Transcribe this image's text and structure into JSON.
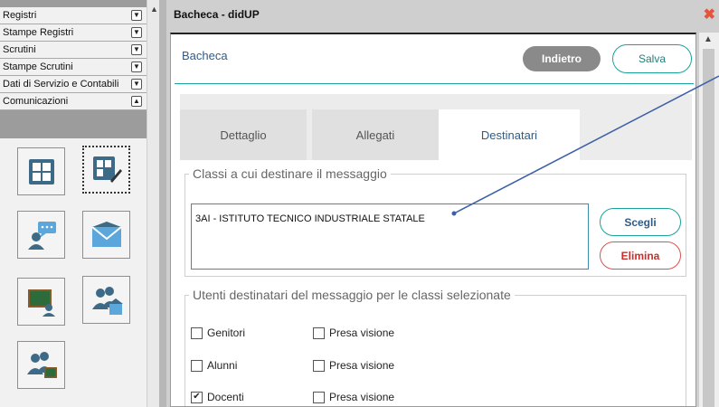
{
  "sidebar": {
    "menu": [
      {
        "label": "Registri",
        "toggle": "▼"
      },
      {
        "label": "Stampe Registri",
        "toggle": "▼"
      },
      {
        "label": "Scrutini",
        "toggle": "▼"
      },
      {
        "label": "Stampe Scrutini",
        "toggle": "▼"
      },
      {
        "label": "Dati di Servizio e Contabili",
        "toggle": "▼"
      },
      {
        "label": "Comunicazioni",
        "toggle": "▲"
      }
    ],
    "scroll_up": "▲",
    "tiles": [
      {
        "icon": "grid-board-icon"
      },
      {
        "icon": "grid-edit-icon"
      },
      {
        "icon": "person-chat-icon"
      },
      {
        "icon": "envelope-icon"
      },
      {
        "icon": "blackboard-teacher-icon"
      },
      {
        "icon": "people-building-icon"
      },
      {
        "icon": "people-board-icon"
      }
    ]
  },
  "dialog": {
    "title": "Bacheca - didUP",
    "close": "✖",
    "scroll_up": "▲"
  },
  "header": {
    "title": "Bacheca",
    "back_label": "Indietro",
    "save_label": "Salva"
  },
  "tabs": [
    {
      "label": "Dettaglio",
      "active": false
    },
    {
      "label": "Allegati",
      "active": false
    },
    {
      "label": "Destinatari",
      "active": true
    }
  ],
  "classes_section": {
    "legend": "Classi a cui destinare il messaggio",
    "value": "3AI - ISTITUTO TECNICO INDUSTRIALE STATALE",
    "choose_label": "Scegli",
    "remove_label": "Elimina"
  },
  "users_section": {
    "legend": "Utenti destinatari del messaggio per le classi selezionate",
    "rows": [
      {
        "label": "Genitori",
        "checked": false,
        "view_label": "Presa visione",
        "view_checked": false
      },
      {
        "label": "Alunni",
        "checked": false,
        "view_label": "Presa visione",
        "view_checked": false
      },
      {
        "label": "Docenti",
        "checked": true,
        "view_label": "Presa visione",
        "view_checked": false
      }
    ]
  },
  "colors": {
    "accent": "#1aa39a",
    "title_blue": "#2f5c86",
    "danger": "#d9534f",
    "close": "#e8543b"
  }
}
